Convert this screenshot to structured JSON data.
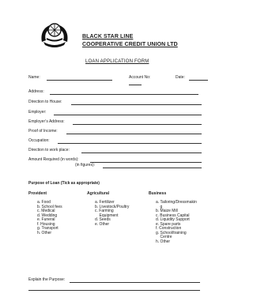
{
  "header": {
    "org_line1": "BLACK STAR LINE",
    "org_line2": "COOPERATIVE CREDIT UNION LTD",
    "form_title": "LOAN APPLICATION FORM"
  },
  "fields": {
    "name": "Name:",
    "account_no": "Account No:",
    "date": "Date:",
    "address": "Address:",
    "direction_to_house": "Direction to House:",
    "employer": "Employer:",
    "employer_address": "Employer’s Address:",
    "proof_of_income": "Proof of Income:",
    "occupation": "Occupation:",
    "direction_to_work": "Direction to work place:",
    "amount_words": "Amount Required (in words):",
    "amount_figures": "(in figures):",
    "explain_purpose": "Explain the Purpose:"
  },
  "purpose": {
    "heading": "Purpose of Loan (Tick as appropriate)",
    "provident": {
      "title": "Provident",
      "items": [
        "a.  Food",
        "b.  School fees",
        "c.  Medical",
        "d.  Wedding",
        "e.  Funeral",
        "f.  Housing",
        "g.  Transport",
        "h.  Other"
      ]
    },
    "agricultural": {
      "title": "Agricultural",
      "items": [
        "a.  Fertilizer",
        "b.  Livestock/Poultry",
        "c.  Farming",
        "    Equipment",
        "d.  Seeds",
        "e.  Other"
      ]
    },
    "business": {
      "title": "Business",
      "items": [
        "a.  Tailoring/Dressmakin",
        "    g",
        "b.  Maize Mill",
        "c.  Business Capital",
        "d.  Liquidity Support",
        "e.  Spare parts",
        "f.   Construction",
        "g.  School/training",
        "    Centre",
        "h.  Other"
      ]
    }
  }
}
